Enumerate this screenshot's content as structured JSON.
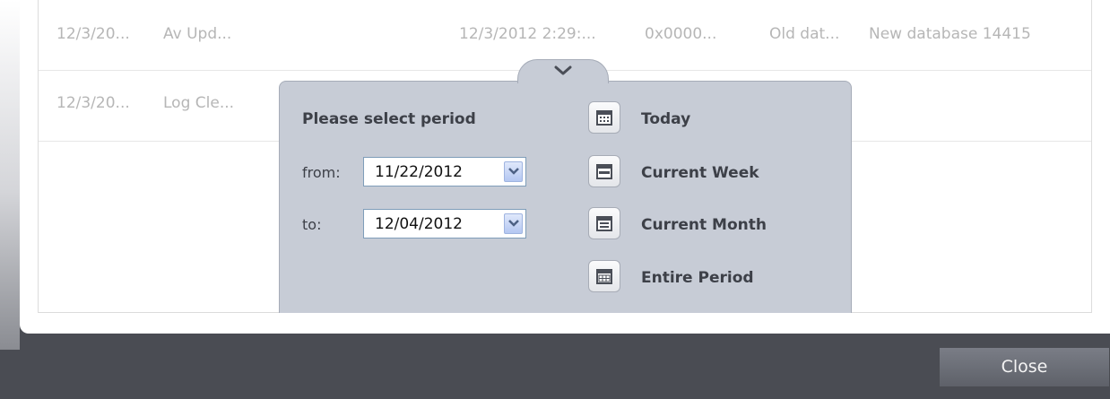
{
  "log_table": {
    "rows": [
      {
        "date": "12/3/20...",
        "type": "Av Upd...",
        "time": "12/3/2012 2:29:...",
        "code": "0x0000...",
        "old_value": "Old dat...",
        "new_value": "New database 14415"
      },
      {
        "date": "12/3/20...",
        "type": "Log Cle..."
      }
    ]
  },
  "period_popup": {
    "title": "Please select period",
    "from_label": "from:",
    "to_label": "to:",
    "from_value": "11/22/2012",
    "to_value": "12/04/2012",
    "options": [
      {
        "label": "Today",
        "icon": "calendar-day-icon"
      },
      {
        "label": "Current Week",
        "icon": "calendar-week-icon"
      },
      {
        "label": "Current Month",
        "icon": "calendar-month-icon"
      },
      {
        "label": "Entire Period",
        "icon": "calendar-all-icon"
      }
    ]
  },
  "footer": {
    "close_label": "Close"
  },
  "colors": {
    "popup_bg": "#c7ccd6",
    "dark_bg": "#4a4c53",
    "text_gray": "#b6b6b6"
  }
}
